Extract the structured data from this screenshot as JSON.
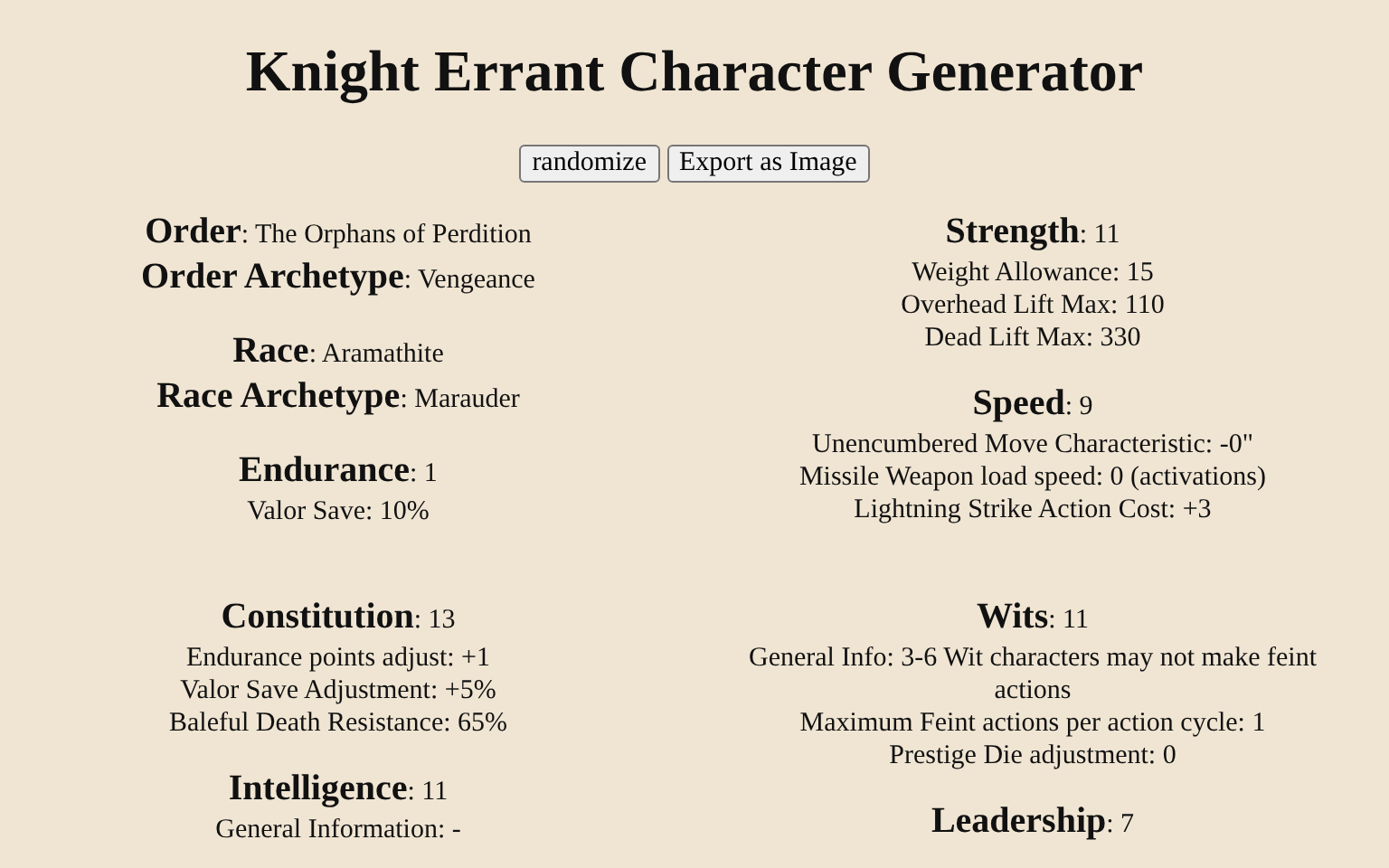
{
  "title": "Knight Errant Character Generator",
  "buttons": [
    {
      "label": "randomize"
    },
    {
      "label": "Export as Image"
    }
  ],
  "sections": [
    {
      "left": [
        {
          "stats": [
            "**Order**: The Orphans of Perdition",
            "**Order Archetype**: Vengeance"
          ]
        },
        {
          "stats": [
            "**Race**: Aramathite",
            "**Race Archetype**: Marauder"
          ]
        },
        {
          "stats": [
            "**Endurance**: 1"
          ],
          "details": [
            "Valor Save: 10%"
          ]
        }
      ],
      "right": [
        {
          "stats": [
            "**Strength**: 11"
          ],
          "details": [
            "Weight Allowance: 15",
            "Overhead Lift Max: 110",
            "Dead Lift Max: 330"
          ]
        },
        {
          "stats": [
            "**Speed**: 9"
          ],
          "details": [
            "Unencumbered Move Characteristic: -0\"",
            "Missile Weapon load speed: 0 (activations)",
            "Lightning Strike Action Cost: +3"
          ]
        }
      ]
    },
    {
      "left": [
        {
          "stats": [
            "**Constitution**: 13"
          ],
          "details": [
            "Endurance points adjust: +1",
            "Valor Save Adjustment: +5%",
            "Baleful Death Resistance: 65%"
          ]
        },
        {
          "stats": [
            "**Intelligence**: 11"
          ],
          "details": [
            "General Information: -"
          ]
        }
      ],
      "right": [
        {
          "stats": [
            "**Wits**: 11"
          ],
          "details": [
            "General Info: 3-6 Wit characters may not make feint actions",
            "Maximum Feint actions per action cycle: 1",
            "Prestige Die adjustment: 0"
          ]
        },
        {
          "stats": [
            "**Leadership**: 7"
          ]
        }
      ]
    }
  ]
}
